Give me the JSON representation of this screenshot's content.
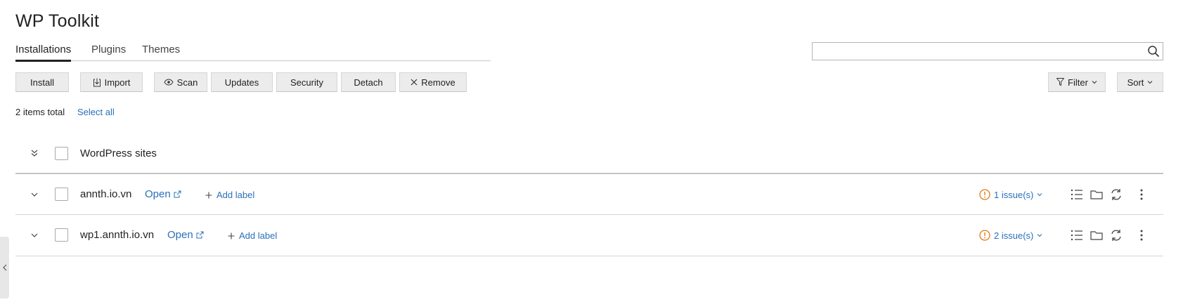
{
  "page": {
    "title": "WP Toolkit"
  },
  "tabs": [
    {
      "label": "Installations",
      "active": true
    },
    {
      "label": "Plugins",
      "active": false
    },
    {
      "label": "Themes",
      "active": false
    }
  ],
  "search": {
    "value": "",
    "placeholder": ""
  },
  "toolbar": {
    "install": "Install",
    "import": "Import",
    "scan": "Scan",
    "updates": "Updates",
    "security": "Security",
    "detach": "Detach",
    "remove": "Remove",
    "filter": "Filter",
    "sort": "Sort"
  },
  "summary": {
    "total": "2 items total",
    "select_all": "Select all"
  },
  "group": {
    "label": "WordPress sites"
  },
  "sites": [
    {
      "domain": "annth.io.vn",
      "open": "Open",
      "add_label": "Add label",
      "issues": "1 issue(s)"
    },
    {
      "domain": "wp1.annth.io.vn",
      "open": "Open",
      "add_label": "Add label",
      "issues": "2 issue(s)"
    }
  ],
  "colors": {
    "link": "#2a70b8",
    "warning": "#e07b1a",
    "button_bg": "#ececec"
  }
}
